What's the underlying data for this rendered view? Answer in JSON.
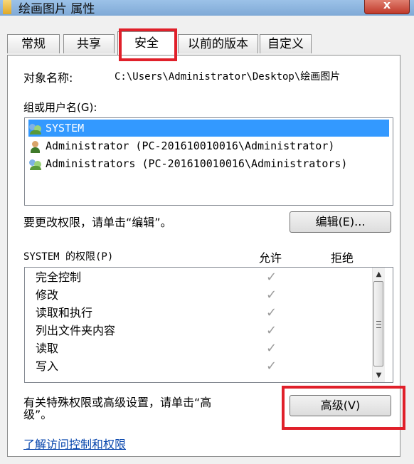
{
  "window": {
    "title": "绘画图片 属性",
    "close_label": "x"
  },
  "tabs": [
    {
      "label": "常规"
    },
    {
      "label": "共享"
    },
    {
      "label": "安全"
    },
    {
      "label": "以前的版本"
    },
    {
      "label": "自定义"
    }
  ],
  "security": {
    "object_name_label": "对象名称:",
    "object_name_value": "C:\\Users\\Administrator\\Desktop\\绘画图片",
    "group_label": "组或用户名(G):",
    "users": [
      {
        "name": "SYSTEM"
      },
      {
        "name": "Administrator (PC-201610010016\\Administrator)"
      },
      {
        "name": "Administrators (PC-201610010016\\Administrators)"
      }
    ],
    "edit_hint": "要更改权限，请单击“编辑”。",
    "edit_button": "编辑(E)...",
    "permissions_label": "SYSTEM 的权限(P)",
    "allow_header": "允许",
    "deny_header": "拒绝",
    "permissions": [
      {
        "name": "完全控制",
        "allow": "✓"
      },
      {
        "name": "修改",
        "allow": "✓"
      },
      {
        "name": "读取和执行",
        "allow": "✓"
      },
      {
        "name": "列出文件夹内容",
        "allow": "✓"
      },
      {
        "name": "读取",
        "allow": "✓"
      },
      {
        "name": "写入",
        "allow": "✓"
      }
    ],
    "advanced_hint_line1": "有关特殊权限或高级设置，请单击“高",
    "advanced_hint_line2": "级”。",
    "advanced_button": "高级(V)",
    "learn_link": "了解访问控制和权限"
  },
  "colors": {
    "selection": "#3399ff",
    "highlight": "#e0202a",
    "link": "#0645ad"
  }
}
